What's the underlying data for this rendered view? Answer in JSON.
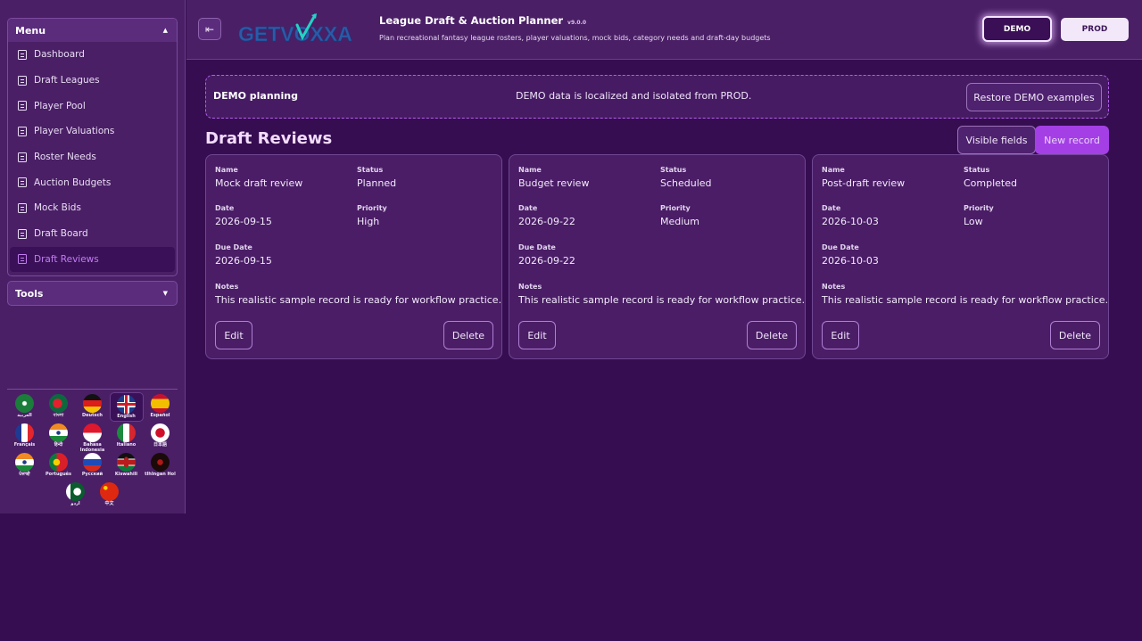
{
  "sidebar": {
    "menu_title": "Menu",
    "items": [
      {
        "label": "Dashboard"
      },
      {
        "label": "Draft Leagues"
      },
      {
        "label": "Player Pool"
      },
      {
        "label": "Player Valuations"
      },
      {
        "label": "Roster Needs"
      },
      {
        "label": "Auction Budgets"
      },
      {
        "label": "Mock Bids"
      },
      {
        "label": "Draft Board"
      },
      {
        "label": "Draft Reviews",
        "active": true
      }
    ],
    "tools_title": "Tools"
  },
  "languages": [
    {
      "label": "العربية",
      "flag": "saudi-arabia-flag"
    },
    {
      "label": "বাংলা",
      "flag": "bangladesh-flag"
    },
    {
      "label": "Deutsch",
      "flag": "germany-flag"
    },
    {
      "label": "English",
      "flag": "uk-flag",
      "active": true
    },
    {
      "label": "Español",
      "flag": "spain-flag"
    },
    {
      "label": "Français",
      "flag": "france-flag"
    },
    {
      "label": "हिन्दी",
      "flag": "india-flag"
    },
    {
      "label": "Bahasa Indonesia",
      "flag": "indonesia-flag"
    },
    {
      "label": "Italiano",
      "flag": "italy-flag"
    },
    {
      "label": "日本語",
      "flag": "japan-flag"
    },
    {
      "label": "ਪੰਜਾਬੀ",
      "flag": "india-flag"
    },
    {
      "label": "Português",
      "flag": "portugal-flag"
    },
    {
      "label": "Русский",
      "flag": "russia-flag"
    },
    {
      "label": "Kiswahili",
      "flag": "kenya-flag"
    },
    {
      "label": "tlhIngan Hol",
      "flag": "klingon-flag"
    },
    {
      "label": "اردو",
      "flag": "pakistan-flag"
    },
    {
      "label": "中文",
      "flag": "china-flag"
    }
  ],
  "header": {
    "logo_text": "GETVOXXA",
    "title": "League Draft & Auction Planner",
    "version": "v9.0.0",
    "subtitle": "Plan recreational fantasy league rosters, player valuations, mock bids, category needs and draft-day budgets",
    "demo_label": "DEMO",
    "prod_label": "PROD"
  },
  "banner": {
    "title": "DEMO planning",
    "message": "DEMO data is localized and isolated from PROD.",
    "restore_label": "Restore DEMO examples"
  },
  "section": {
    "title": "Draft Reviews",
    "visible_fields_label": "Visible fields",
    "new_record_label": "New record"
  },
  "labels": {
    "name": "Name",
    "status": "Status",
    "date": "Date",
    "priority": "Priority",
    "due_date": "Due Date",
    "notes": "Notes",
    "edit": "Edit",
    "delete": "Delete"
  },
  "records": [
    {
      "name": "Mock draft review",
      "status": "Planned",
      "date": "2026-09-15",
      "priority": "High",
      "due_date": "2026-09-15",
      "notes": "This realistic sample record is ready for workflow practice."
    },
    {
      "name": "Budget review",
      "status": "Scheduled",
      "date": "2026-09-22",
      "priority": "Medium",
      "due_date": "2026-09-22",
      "notes": "This realistic sample record is ready for workflow practice."
    },
    {
      "name": "Post-draft review",
      "status": "Completed",
      "date": "2026-10-03",
      "priority": "Low",
      "due_date": "2026-10-03",
      "notes": "This realistic sample record is ready for workflow practice."
    }
  ],
  "colors": {
    "background": "#360d50",
    "panel": "#4a1f66",
    "accent": "#a43fe6",
    "active_text": "#c27cf2"
  }
}
